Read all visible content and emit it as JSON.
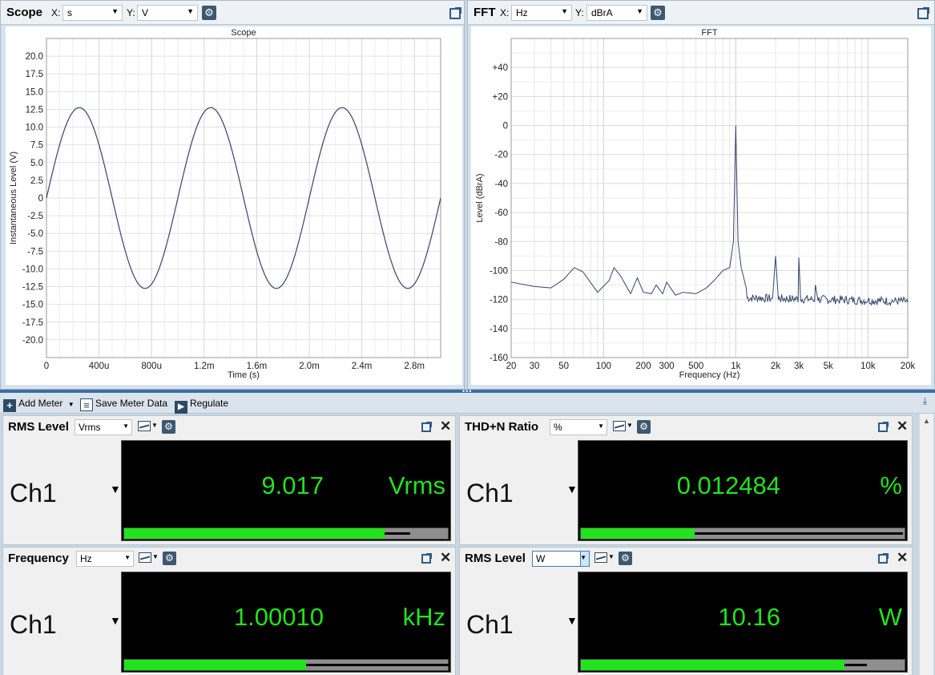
{
  "scope": {
    "title": "Scope",
    "x_label": "X:",
    "x_unit": "s",
    "y_label": "Y:",
    "y_unit": "V",
    "gear_icon": "gear-icon",
    "popout_icon": "popout-icon"
  },
  "fft": {
    "title": "FFT",
    "x_label": "X:",
    "x_unit": "Hz",
    "y_label": "Y:",
    "y_unit": "dBrA"
  },
  "chart_data": [
    {
      "type": "line",
      "title": "Scope",
      "xlabel": "Time (s)",
      "ylabel": "Instantaneous Level (V)",
      "xlim": [
        0,
        0.003
      ],
      "ylim": [
        -22.5,
        22.5
      ],
      "x_ticks": [
        "0",
        "400u",
        "800u",
        "1.2m",
        "1.6m",
        "2.0m",
        "2.4m",
        "2.8m"
      ],
      "y_ticks": [
        "20.0",
        "17.5",
        "15.0",
        "12.5",
        "10.0",
        "7.5",
        "5.0",
        "2.5",
        "0",
        "-2.5",
        "-5.0",
        "-7.5",
        "-10.0",
        "-12.5",
        "-15.0",
        "-17.5",
        "-20.0"
      ],
      "grid": true,
      "series": [
        {
          "amplitude_v": 12.75,
          "frequency_hz": 1000,
          "color": "#33466b"
        }
      ]
    },
    {
      "type": "line",
      "title": "FFT",
      "xlabel": "Frequency (Hz)",
      "ylabel": "Level (dBrA)",
      "xscale": "log",
      "xlim": [
        20,
        20000
      ],
      "ylim": [
        -160,
        60
      ],
      "x_ticks": [
        "20",
        "30",
        "50",
        "100",
        "200",
        "300",
        "500",
        "1k",
        "2k",
        "3k",
        "5k",
        "10k",
        "20k"
      ],
      "y_ticks": [
        "+40",
        "+20",
        "0",
        "-20",
        "-40",
        "-60",
        "-80",
        "-100",
        "-120",
        "-140",
        "-160"
      ],
      "grid": true,
      "series": [
        {
          "color": "#33466b",
          "points": [
            [
              20,
              -108
            ],
            [
              30,
              -111
            ],
            [
              40,
              -112
            ],
            [
              50,
              -106
            ],
            [
              60,
              -98
            ],
            [
              70,
              -101
            ],
            [
              90,
              -115
            ],
            [
              110,
              -107
            ],
            [
              120,
              -98
            ],
            [
              135,
              -104
            ],
            [
              160,
              -116
            ],
            [
              180,
              -105
            ],
            [
              200,
              -115
            ],
            [
              230,
              -116
            ],
            [
              250,
              -110
            ],
            [
              280,
              -116
            ],
            [
              300,
              -108
            ],
            [
              350,
              -117
            ],
            [
              400,
              -115
            ],
            [
              500,
              -116
            ],
            [
              600,
              -112
            ],
            [
              700,
              -106
            ],
            [
              800,
              -100
            ],
            [
              900,
              -98
            ],
            [
              960,
              -80
            ],
            [
              1000,
              0
            ],
            [
              1040,
              -80
            ],
            [
              1100,
              -98
            ],
            [
              1200,
              -112
            ],
            [
              1500,
              -118
            ],
            [
              1900,
              -119
            ],
            [
              2000,
              -90
            ],
            [
              2100,
              -120
            ],
            [
              2600,
              -121
            ],
            [
              3000,
              -91
            ],
            [
              3100,
              -121
            ],
            [
              4000,
              -110
            ],
            [
              4200,
              -121
            ],
            [
              6000,
              -121
            ],
            [
              10000,
              -121
            ],
            [
              15000,
              -122
            ],
            [
              20000,
              -122
            ]
          ]
        }
      ]
    }
  ],
  "toolbar": {
    "add_meter": "Add Meter",
    "save_meter_data": "Save Meter Data",
    "regulate": "Regulate"
  },
  "meters": [
    {
      "title": "RMS Level",
      "unit_select": "Vrms",
      "channel": "Ch1",
      "value": "9.017",
      "unit": "Vrms",
      "bar_fraction": 0.8,
      "peak_fraction": 0.88
    },
    {
      "title": "THD+N Ratio",
      "unit_select": "%",
      "channel": "Ch1",
      "value": "0.012484",
      "unit": "%",
      "bar_fraction": 0.35,
      "peak_fraction": 0.99
    },
    {
      "title": "Frequency",
      "unit_select": "Hz",
      "channel": "Ch1",
      "value": "1.00010",
      "unit": "kHz",
      "bar_fraction": 0.56,
      "peak_fraction": 0.999
    },
    {
      "title": "RMS Level",
      "unit_select": "W",
      "channel": "Ch1",
      "value": "10.16",
      "unit": "W",
      "bar_fraction": 0.81,
      "peak_fraction": 0.88
    }
  ],
  "colors": {
    "accent": "#3a6ea5",
    "meter_green": "#22e31c",
    "trace": "#33466b"
  }
}
